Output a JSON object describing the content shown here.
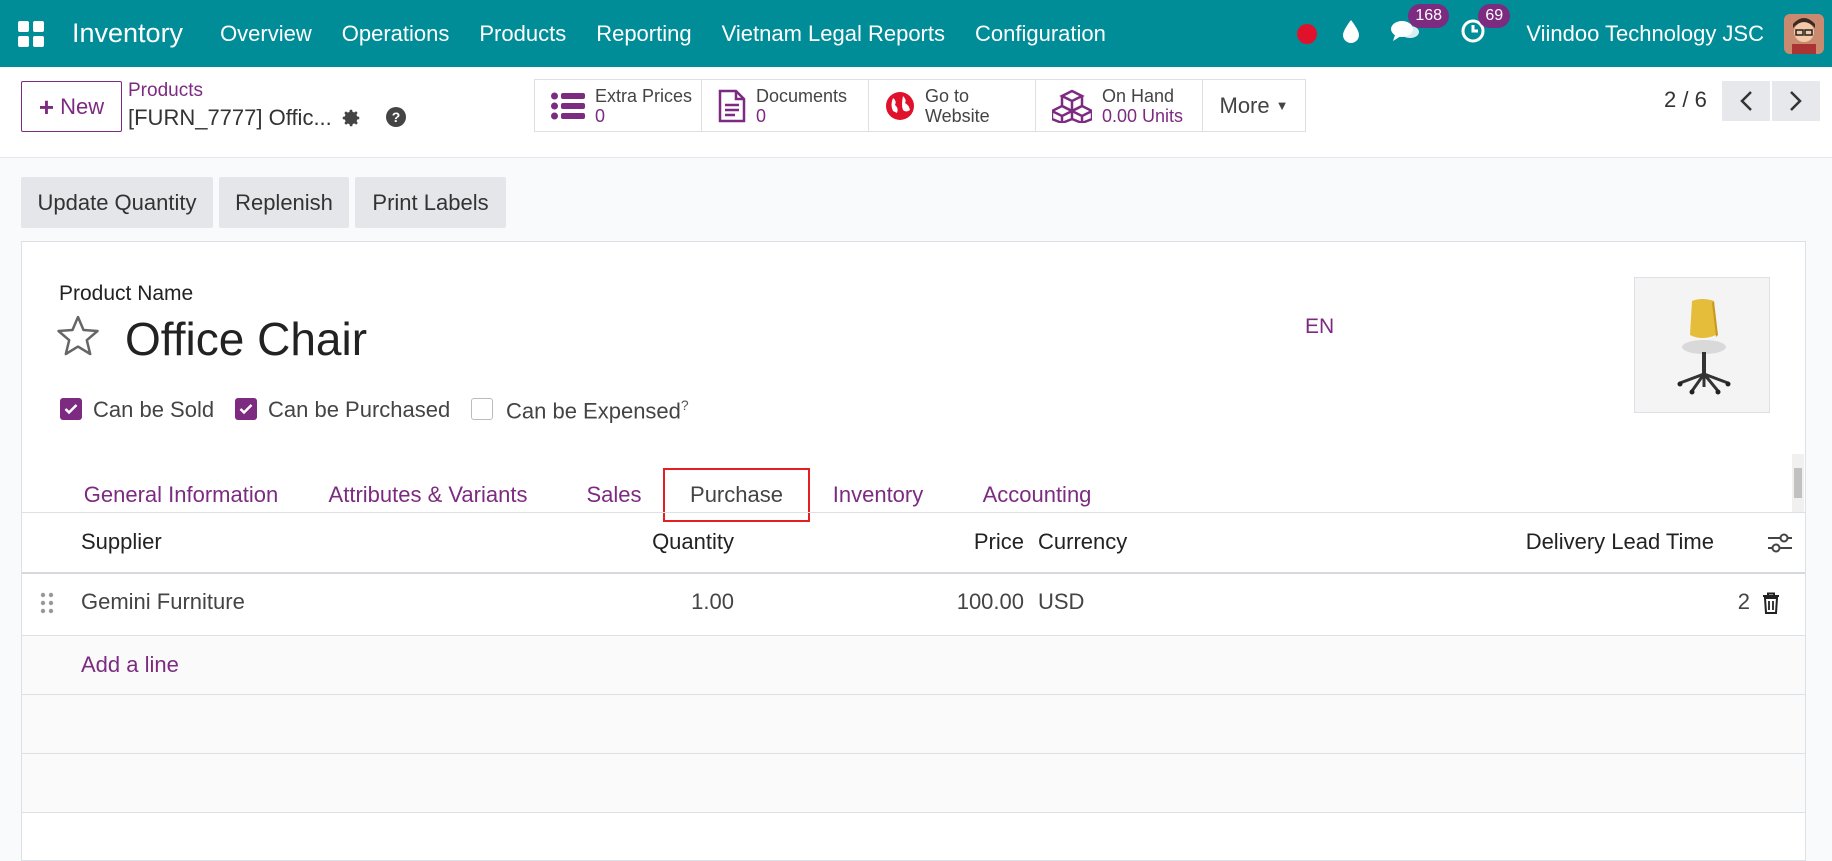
{
  "navbar": {
    "brand": "Inventory",
    "menu": [
      "Overview",
      "Operations",
      "Products",
      "Reporting",
      "Vietnam Legal Reports",
      "Configuration"
    ],
    "messages_count": "168",
    "activities_count": "69",
    "company": "Viindoo Technology JSC"
  },
  "control": {
    "new_label": "New",
    "breadcrumb_parent": "Products",
    "breadcrumb_current": "[FURN_7777] Offic...",
    "smart_buttons": [
      {
        "label": "Extra Prices",
        "value": "0",
        "icon": "list-icon"
      },
      {
        "label": "Documents",
        "value": "0",
        "icon": "document-icon"
      },
      {
        "label": "Go to",
        "value": "Website",
        "icon": "globe-icon"
      },
      {
        "label": "On Hand",
        "value": "0.00 Units",
        "icon": "cubes-icon"
      }
    ],
    "more_label": "More",
    "pager": "2 / 6"
  },
  "actions": [
    "Update Quantity",
    "Replenish",
    "Print Labels"
  ],
  "form": {
    "product_name_label": "Product Name",
    "product_name": "Office Chair",
    "lang": "EN",
    "checkboxes": [
      {
        "label": "Can be Sold",
        "checked": true
      },
      {
        "label": "Can be Purchased",
        "checked": true
      },
      {
        "label": "Can be Expensed",
        "checked": false,
        "help": "?"
      }
    ],
    "tabs": [
      "General Information",
      "Attributes & Variants",
      "Sales",
      "Purchase",
      "Inventory",
      "Accounting"
    ],
    "active_tab": "Purchase"
  },
  "table": {
    "headers": {
      "supplier": "Supplier",
      "quantity": "Quantity",
      "price": "Price",
      "currency": "Currency",
      "lead_time": "Delivery Lead Time"
    },
    "rows": [
      {
        "supplier": "Gemini Furniture",
        "quantity": "1.00",
        "price": "100.00",
        "currency": "USD",
        "lead_time": "2"
      }
    ],
    "add_line": "Add a line"
  },
  "colors": {
    "navbar": "#018d98",
    "accent": "#7c2b81",
    "highlight": "#e31e24"
  }
}
